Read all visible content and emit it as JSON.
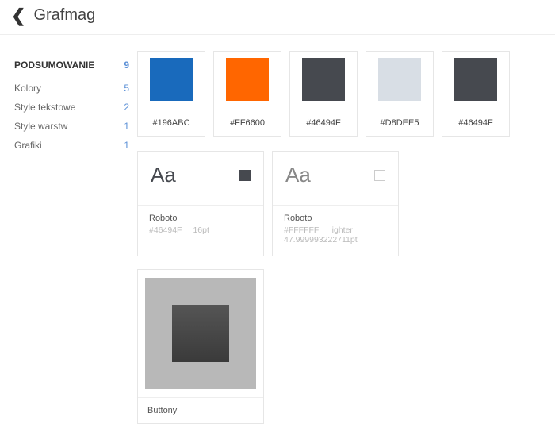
{
  "header": {
    "title": "Grafmag"
  },
  "sidebar": {
    "summary": {
      "label": "PODSUMOWANIE",
      "count": "9"
    },
    "items": [
      {
        "label": "Kolory",
        "count": "5"
      },
      {
        "label": "Style tekstowe",
        "count": "2"
      },
      {
        "label": "Style warstw",
        "count": "1"
      },
      {
        "label": "Grafiki",
        "count": "1"
      }
    ]
  },
  "colors": [
    {
      "hex": "#196ABC"
    },
    {
      "hex": "#FF6600"
    },
    {
      "hex": "#46494F"
    },
    {
      "hex": "#D8DEE5"
    },
    {
      "hex": "#46494F"
    }
  ],
  "textStyles": [
    {
      "sample": "Aa",
      "swatchColor": "#46494F",
      "font": "Roboto",
      "color": "#46494F",
      "size": "16pt",
      "weight": "",
      "dark": true
    },
    {
      "sample": "Aa",
      "swatchColor": "outline",
      "font": "Roboto",
      "color": "#FFFFFF",
      "size": "47.999993222711pt",
      "weight": "lighter",
      "dark": false
    }
  ],
  "layerStyles": [
    {
      "name": "Buttony"
    }
  ]
}
